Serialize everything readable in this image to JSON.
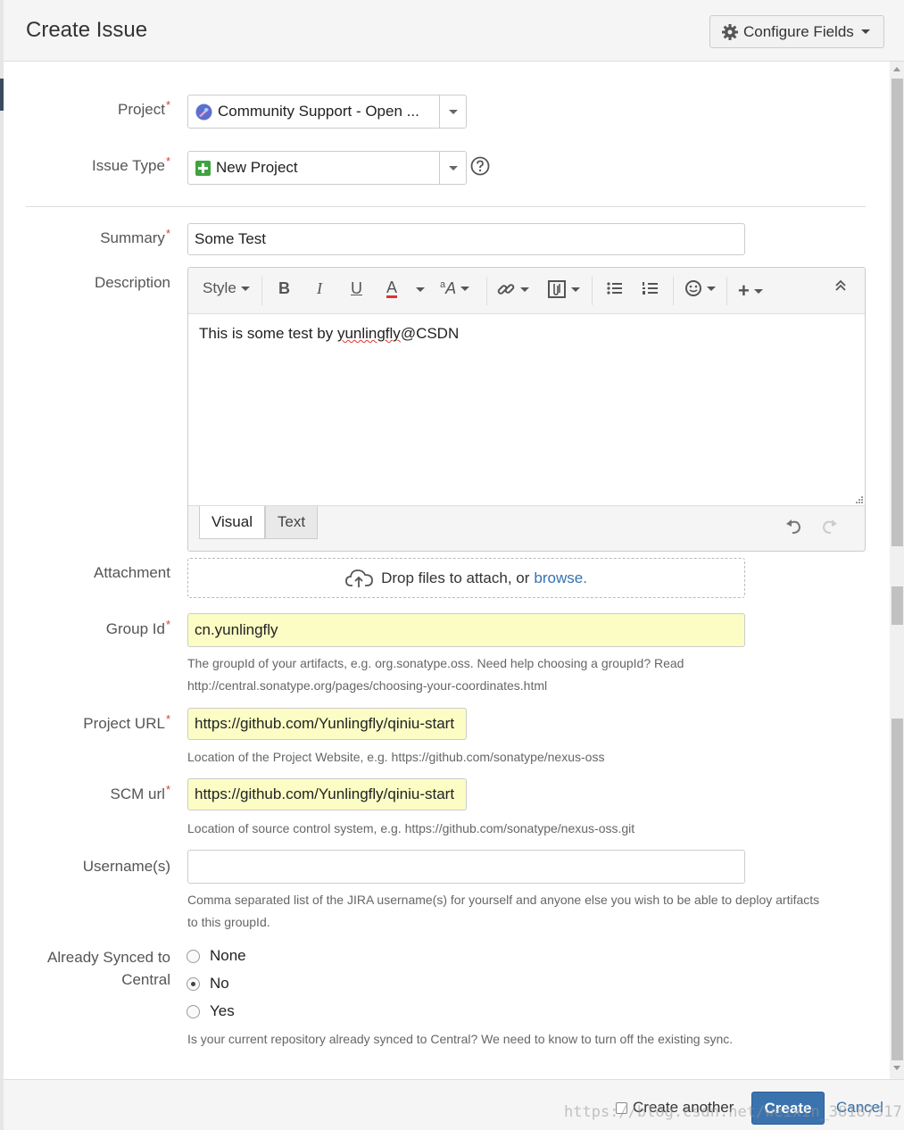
{
  "dialog": {
    "title": "Create Issue",
    "configure_fields_label": "Configure Fields",
    "accent_color": "#3b73af",
    "required_color": "#d04437",
    "highlight_field_color": "#fbfdc4"
  },
  "fields": {
    "project": {
      "label": "Project",
      "value": "Community Support - Open ..."
    },
    "issue_type": {
      "label": "Issue Type",
      "value": "New Project"
    },
    "summary": {
      "label": "Summary",
      "value": "Some Test"
    },
    "description": {
      "label": "Description",
      "text_prefix": "This is some test by ",
      "text_misspelled": "yunlingfly",
      "text_suffix": "@CSDN",
      "toolbar_style_label": "Style",
      "tab_visual": "Visual",
      "tab_text": "Text"
    },
    "attachment": {
      "label": "Attachment",
      "drop_text": "Drop files to attach, or",
      "browse_link": "browse."
    },
    "group_id": {
      "label": "Group Id",
      "value": "cn.yunlingfly",
      "hint_line1": "The groupId of your artifacts, e.g. org.sonatype.oss. Need help choosing a groupId? Read",
      "hint_line2": "http://central.sonatype.org/pages/choosing-your-coordinates.html"
    },
    "project_url": {
      "label": "Project URL",
      "value": "https://github.com/Yunlingfly/qiniu-start",
      "hint": "Location of the Project Website, e.g. https://github.com/sonatype/nexus-oss"
    },
    "scm_url": {
      "label": "SCM url",
      "value": "https://github.com/Yunlingfly/qiniu-start",
      "hint": "Location of source control system, e.g. https://github.com/sonatype/nexus-oss.git"
    },
    "usernames": {
      "label": "Username(s)",
      "value": "",
      "hint_line1": "Comma separated list of the JIRA username(s) for yourself and anyone else you wish to be able to deploy artifacts",
      "hint_line2": "to this groupId."
    },
    "already_synced": {
      "label_line1": "Already Synced to",
      "label_line2": "Central",
      "options": [
        "None",
        "No",
        "Yes"
      ],
      "selected": "No",
      "hint": "Is your current repository already synced to Central? We need to know to turn off the existing sync."
    }
  },
  "footer": {
    "create_another_label": "Create another",
    "create_another_checked": false,
    "create_label": "Create",
    "cancel_label": "Cancel",
    "watermark": "https://blog.csdn.net/weixin_38187317"
  },
  "required_marker": "*"
}
